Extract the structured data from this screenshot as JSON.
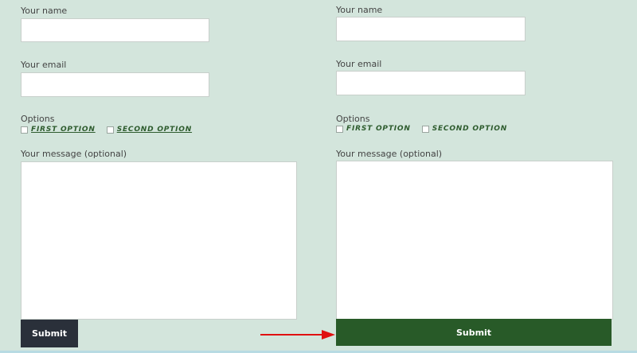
{
  "before_form": {
    "name_label": "Your name",
    "email_label": "Your email",
    "options_label": "Options",
    "options": [
      "FIRST OPTION",
      "SECOND OPTION"
    ],
    "message_label": "Your message (optional)",
    "submit_label": "Submit"
  },
  "after_form": {
    "name_label": "Your name",
    "email_label": "Your email",
    "options_label": "Options",
    "options": [
      "FIRST OPTION",
      "SECOND OPTION"
    ],
    "message_label": "Your message (optional)",
    "submit_label": "Submit"
  },
  "colors": {
    "background": "#d3e5dc",
    "option_text": "#2e5c2e",
    "submit_before": "#2a303a",
    "submit_after": "#285a28",
    "arrow": "#e01010"
  },
  "icons": {
    "annotation": "arrow-right-icon"
  }
}
